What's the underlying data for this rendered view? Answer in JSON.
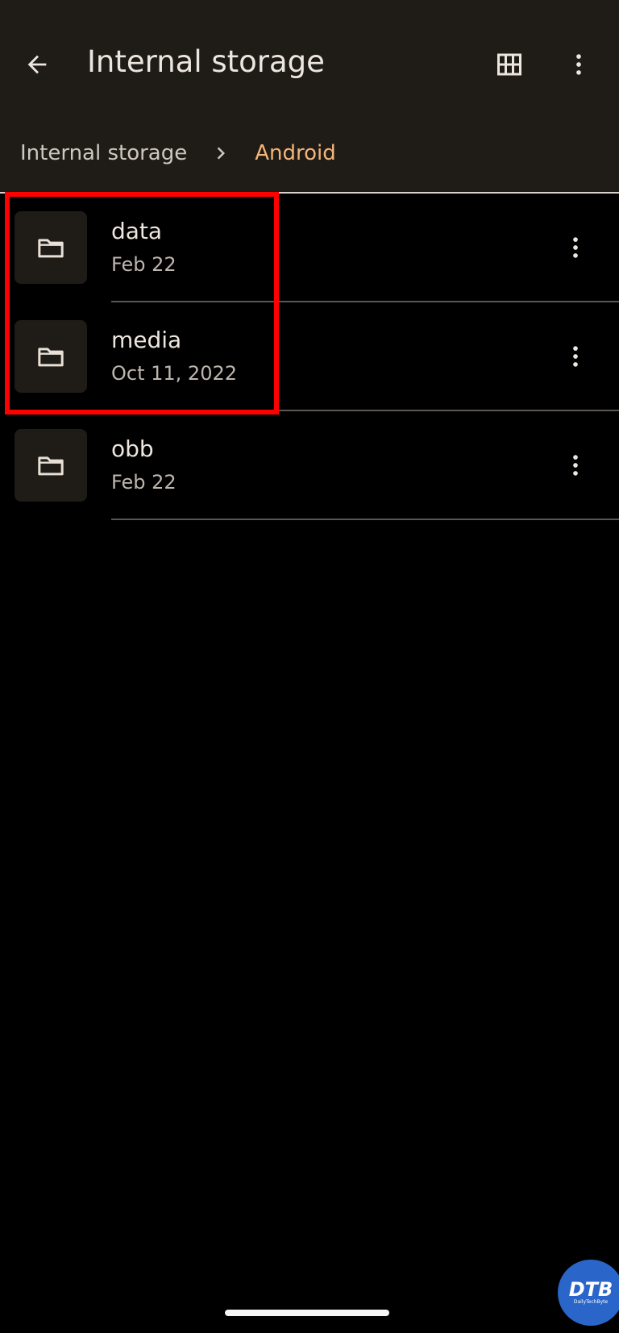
{
  "header": {
    "title": "Internal storage",
    "back_icon": "arrow-left-icon",
    "grid_icon": "grid-view-icon",
    "more_icon": "more-vert-icon"
  },
  "breadcrumb": {
    "root": "Internal storage",
    "separator_icon": "chevron-right-icon",
    "current": "Android"
  },
  "files": [
    {
      "name": "data",
      "date": "Feb 22",
      "icon": "folder-icon"
    },
    {
      "name": "media",
      "date": "Oct 11, 2022",
      "icon": "folder-icon"
    },
    {
      "name": "obb",
      "date": "Feb 22",
      "icon": "folder-icon"
    }
  ],
  "watermark": {
    "main": "DTB",
    "sub": "DailyTechByte"
  },
  "colors": {
    "background": "#000000",
    "header_background": "#1f1b17",
    "accent": "#f3b67a",
    "highlight": "#ff0000",
    "text_primary": "#ece6df",
    "text_secondary": "#bfb7ae"
  }
}
